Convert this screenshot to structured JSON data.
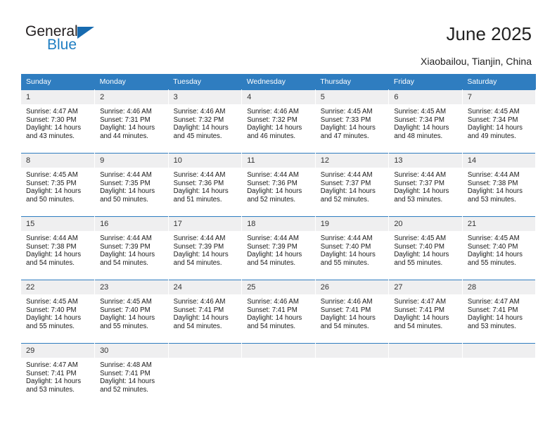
{
  "brand": {
    "name_top": "General",
    "name_bottom": "Blue",
    "triangle_color": "#176bb0",
    "blue_color": "#1f7ec2",
    "top_color": "#231f20"
  },
  "header": {
    "title": "June 2025",
    "location": "Xiaobailou, Tianjin, China"
  },
  "theme": {
    "header_bg": "#2f7dc0",
    "header_text": "#ffffff",
    "daynum_bg": "#efeff0",
    "cell_border": "#2f7dc0",
    "body_text": "#1a1a1a"
  },
  "calendar": {
    "weekday_headers": [
      "Sunday",
      "Monday",
      "Tuesday",
      "Wednesday",
      "Thursday",
      "Friday",
      "Saturday"
    ],
    "labels": {
      "sunrise_prefix": "Sunrise:",
      "sunset_prefix": "Sunset:",
      "daylight_prefix": "Daylight:"
    },
    "weeks": [
      [
        {
          "day": "1",
          "sunrise_line": "Sunrise: 4:47 AM",
          "sunset_line": "Sunset: 7:30 PM",
          "daylight_line_1": "Daylight: 14 hours",
          "daylight_line_2": "and 43 minutes.",
          "sunrise": "4:47 AM",
          "sunset": "7:30 PM",
          "daylight_hours": 14,
          "daylight_minutes": 43
        },
        {
          "day": "2",
          "sunrise_line": "Sunrise: 4:46 AM",
          "sunset_line": "Sunset: 7:31 PM",
          "daylight_line_1": "Daylight: 14 hours",
          "daylight_line_2": "and 44 minutes.",
          "sunrise": "4:46 AM",
          "sunset": "7:31 PM",
          "daylight_hours": 14,
          "daylight_minutes": 44
        },
        {
          "day": "3",
          "sunrise_line": "Sunrise: 4:46 AM",
          "sunset_line": "Sunset: 7:32 PM",
          "daylight_line_1": "Daylight: 14 hours",
          "daylight_line_2": "and 45 minutes.",
          "sunrise": "4:46 AM",
          "sunset": "7:32 PM",
          "daylight_hours": 14,
          "daylight_minutes": 45
        },
        {
          "day": "4",
          "sunrise_line": "Sunrise: 4:46 AM",
          "sunset_line": "Sunset: 7:32 PM",
          "daylight_line_1": "Daylight: 14 hours",
          "daylight_line_2": "and 46 minutes.",
          "sunrise": "4:46 AM",
          "sunset": "7:32 PM",
          "daylight_hours": 14,
          "daylight_minutes": 46
        },
        {
          "day": "5",
          "sunrise_line": "Sunrise: 4:45 AM",
          "sunset_line": "Sunset: 7:33 PM",
          "daylight_line_1": "Daylight: 14 hours",
          "daylight_line_2": "and 47 minutes.",
          "sunrise": "4:45 AM",
          "sunset": "7:33 PM",
          "daylight_hours": 14,
          "daylight_minutes": 47
        },
        {
          "day": "6",
          "sunrise_line": "Sunrise: 4:45 AM",
          "sunset_line": "Sunset: 7:34 PM",
          "daylight_line_1": "Daylight: 14 hours",
          "daylight_line_2": "and 48 minutes.",
          "sunrise": "4:45 AM",
          "sunset": "7:34 PM",
          "daylight_hours": 14,
          "daylight_minutes": 48
        },
        {
          "day": "7",
          "sunrise_line": "Sunrise: 4:45 AM",
          "sunset_line": "Sunset: 7:34 PM",
          "daylight_line_1": "Daylight: 14 hours",
          "daylight_line_2": "and 49 minutes.",
          "sunrise": "4:45 AM",
          "sunset": "7:34 PM",
          "daylight_hours": 14,
          "daylight_minutes": 49
        }
      ],
      [
        {
          "day": "8",
          "sunrise_line": "Sunrise: 4:45 AM",
          "sunset_line": "Sunset: 7:35 PM",
          "daylight_line_1": "Daylight: 14 hours",
          "daylight_line_2": "and 50 minutes.",
          "sunrise": "4:45 AM",
          "sunset": "7:35 PM",
          "daylight_hours": 14,
          "daylight_minutes": 50
        },
        {
          "day": "9",
          "sunrise_line": "Sunrise: 4:44 AM",
          "sunset_line": "Sunset: 7:35 PM",
          "daylight_line_1": "Daylight: 14 hours",
          "daylight_line_2": "and 50 minutes.",
          "sunrise": "4:44 AM",
          "sunset": "7:35 PM",
          "daylight_hours": 14,
          "daylight_minutes": 50
        },
        {
          "day": "10",
          "sunrise_line": "Sunrise: 4:44 AM",
          "sunset_line": "Sunset: 7:36 PM",
          "daylight_line_1": "Daylight: 14 hours",
          "daylight_line_2": "and 51 minutes.",
          "sunrise": "4:44 AM",
          "sunset": "7:36 PM",
          "daylight_hours": 14,
          "daylight_minutes": 51
        },
        {
          "day": "11",
          "sunrise_line": "Sunrise: 4:44 AM",
          "sunset_line": "Sunset: 7:36 PM",
          "daylight_line_1": "Daylight: 14 hours",
          "daylight_line_2": "and 52 minutes.",
          "sunrise": "4:44 AM",
          "sunset": "7:36 PM",
          "daylight_hours": 14,
          "daylight_minutes": 52
        },
        {
          "day": "12",
          "sunrise_line": "Sunrise: 4:44 AM",
          "sunset_line": "Sunset: 7:37 PM",
          "daylight_line_1": "Daylight: 14 hours",
          "daylight_line_2": "and 52 minutes.",
          "sunrise": "4:44 AM",
          "sunset": "7:37 PM",
          "daylight_hours": 14,
          "daylight_minutes": 52
        },
        {
          "day": "13",
          "sunrise_line": "Sunrise: 4:44 AM",
          "sunset_line": "Sunset: 7:37 PM",
          "daylight_line_1": "Daylight: 14 hours",
          "daylight_line_2": "and 53 minutes.",
          "sunrise": "4:44 AM",
          "sunset": "7:37 PM",
          "daylight_hours": 14,
          "daylight_minutes": 53
        },
        {
          "day": "14",
          "sunrise_line": "Sunrise: 4:44 AM",
          "sunset_line": "Sunset: 7:38 PM",
          "daylight_line_1": "Daylight: 14 hours",
          "daylight_line_2": "and 53 minutes.",
          "sunrise": "4:44 AM",
          "sunset": "7:38 PM",
          "daylight_hours": 14,
          "daylight_minutes": 53
        }
      ],
      [
        {
          "day": "15",
          "sunrise_line": "Sunrise: 4:44 AM",
          "sunset_line": "Sunset: 7:38 PM",
          "daylight_line_1": "Daylight: 14 hours",
          "daylight_line_2": "and 54 minutes.",
          "sunrise": "4:44 AM",
          "sunset": "7:38 PM",
          "daylight_hours": 14,
          "daylight_minutes": 54
        },
        {
          "day": "16",
          "sunrise_line": "Sunrise: 4:44 AM",
          "sunset_line": "Sunset: 7:39 PM",
          "daylight_line_1": "Daylight: 14 hours",
          "daylight_line_2": "and 54 minutes.",
          "sunrise": "4:44 AM",
          "sunset": "7:39 PM",
          "daylight_hours": 14,
          "daylight_minutes": 54
        },
        {
          "day": "17",
          "sunrise_line": "Sunrise: 4:44 AM",
          "sunset_line": "Sunset: 7:39 PM",
          "daylight_line_1": "Daylight: 14 hours",
          "daylight_line_2": "and 54 minutes.",
          "sunrise": "4:44 AM",
          "sunset": "7:39 PM",
          "daylight_hours": 14,
          "daylight_minutes": 54
        },
        {
          "day": "18",
          "sunrise_line": "Sunrise: 4:44 AM",
          "sunset_line": "Sunset: 7:39 PM",
          "daylight_line_1": "Daylight: 14 hours",
          "daylight_line_2": "and 54 minutes.",
          "sunrise": "4:44 AM",
          "sunset": "7:39 PM",
          "daylight_hours": 14,
          "daylight_minutes": 54
        },
        {
          "day": "19",
          "sunrise_line": "Sunrise: 4:44 AM",
          "sunset_line": "Sunset: 7:40 PM",
          "daylight_line_1": "Daylight: 14 hours",
          "daylight_line_2": "and 55 minutes.",
          "sunrise": "4:44 AM",
          "sunset": "7:40 PM",
          "daylight_hours": 14,
          "daylight_minutes": 55
        },
        {
          "day": "20",
          "sunrise_line": "Sunrise: 4:45 AM",
          "sunset_line": "Sunset: 7:40 PM",
          "daylight_line_1": "Daylight: 14 hours",
          "daylight_line_2": "and 55 minutes.",
          "sunrise": "4:45 AM",
          "sunset": "7:40 PM",
          "daylight_hours": 14,
          "daylight_minutes": 55
        },
        {
          "day": "21",
          "sunrise_line": "Sunrise: 4:45 AM",
          "sunset_line": "Sunset: 7:40 PM",
          "daylight_line_1": "Daylight: 14 hours",
          "daylight_line_2": "and 55 minutes.",
          "sunrise": "4:45 AM",
          "sunset": "7:40 PM",
          "daylight_hours": 14,
          "daylight_minutes": 55
        }
      ],
      [
        {
          "day": "22",
          "sunrise_line": "Sunrise: 4:45 AM",
          "sunset_line": "Sunset: 7:40 PM",
          "daylight_line_1": "Daylight: 14 hours",
          "daylight_line_2": "and 55 minutes.",
          "sunrise": "4:45 AM",
          "sunset": "7:40 PM",
          "daylight_hours": 14,
          "daylight_minutes": 55
        },
        {
          "day": "23",
          "sunrise_line": "Sunrise: 4:45 AM",
          "sunset_line": "Sunset: 7:40 PM",
          "daylight_line_1": "Daylight: 14 hours",
          "daylight_line_2": "and 55 minutes.",
          "sunrise": "4:45 AM",
          "sunset": "7:40 PM",
          "daylight_hours": 14,
          "daylight_minutes": 55
        },
        {
          "day": "24",
          "sunrise_line": "Sunrise: 4:46 AM",
          "sunset_line": "Sunset: 7:41 PM",
          "daylight_line_1": "Daylight: 14 hours",
          "daylight_line_2": "and 54 minutes.",
          "sunrise": "4:46 AM",
          "sunset": "7:41 PM",
          "daylight_hours": 14,
          "daylight_minutes": 54
        },
        {
          "day": "25",
          "sunrise_line": "Sunrise: 4:46 AM",
          "sunset_line": "Sunset: 7:41 PM",
          "daylight_line_1": "Daylight: 14 hours",
          "daylight_line_2": "and 54 minutes.",
          "sunrise": "4:46 AM",
          "sunset": "7:41 PM",
          "daylight_hours": 14,
          "daylight_minutes": 54
        },
        {
          "day": "26",
          "sunrise_line": "Sunrise: 4:46 AM",
          "sunset_line": "Sunset: 7:41 PM",
          "daylight_line_1": "Daylight: 14 hours",
          "daylight_line_2": "and 54 minutes.",
          "sunrise": "4:46 AM",
          "sunset": "7:41 PM",
          "daylight_hours": 14,
          "daylight_minutes": 54
        },
        {
          "day": "27",
          "sunrise_line": "Sunrise: 4:47 AM",
          "sunset_line": "Sunset: 7:41 PM",
          "daylight_line_1": "Daylight: 14 hours",
          "daylight_line_2": "and 54 minutes.",
          "sunrise": "4:47 AM",
          "sunset": "7:41 PM",
          "daylight_hours": 14,
          "daylight_minutes": 54
        },
        {
          "day": "28",
          "sunrise_line": "Sunrise: 4:47 AM",
          "sunset_line": "Sunset: 7:41 PM",
          "daylight_line_1": "Daylight: 14 hours",
          "daylight_line_2": "and 53 minutes.",
          "sunrise": "4:47 AM",
          "sunset": "7:41 PM",
          "daylight_hours": 14,
          "daylight_minutes": 53
        }
      ],
      [
        {
          "day": "29",
          "sunrise_line": "Sunrise: 4:47 AM",
          "sunset_line": "Sunset: 7:41 PM",
          "daylight_line_1": "Daylight: 14 hours",
          "daylight_line_2": "and 53 minutes.",
          "sunrise": "4:47 AM",
          "sunset": "7:41 PM",
          "daylight_hours": 14,
          "daylight_minutes": 53
        },
        {
          "day": "30",
          "sunrise_line": "Sunrise: 4:48 AM",
          "sunset_line": "Sunset: 7:41 PM",
          "daylight_line_1": "Daylight: 14 hours",
          "daylight_line_2": "and 52 minutes.",
          "sunrise": "4:48 AM",
          "sunset": "7:41 PM",
          "daylight_hours": 14,
          "daylight_minutes": 52
        },
        {
          "day": "",
          "sunrise_line": "",
          "sunset_line": "",
          "daylight_line_1": "",
          "daylight_line_2": ""
        },
        {
          "day": "",
          "sunrise_line": "",
          "sunset_line": "",
          "daylight_line_1": "",
          "daylight_line_2": ""
        },
        {
          "day": "",
          "sunrise_line": "",
          "sunset_line": "",
          "daylight_line_1": "",
          "daylight_line_2": ""
        },
        {
          "day": "",
          "sunrise_line": "",
          "sunset_line": "",
          "daylight_line_1": "",
          "daylight_line_2": ""
        },
        {
          "day": "",
          "sunrise_line": "",
          "sunset_line": "",
          "daylight_line_1": "",
          "daylight_line_2": ""
        }
      ]
    ]
  }
}
